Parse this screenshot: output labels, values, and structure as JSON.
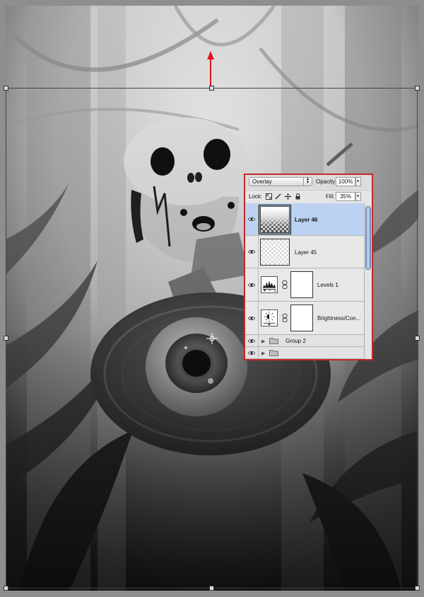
{
  "layers_panel": {
    "blend_mode": "Overlay",
    "opacity_label": "Opacity:",
    "opacity_value": "100%",
    "lock_label": "Lock:",
    "fill_label": "Fill:",
    "fill_value": "35%",
    "layers": [
      {
        "name": "Layer 46",
        "selected": true
      },
      {
        "name": "Layer 45",
        "selected": false
      },
      {
        "name": "Levels 1",
        "selected": false
      },
      {
        "name": "Brightness/Con...",
        "selected": false
      },
      {
        "name": "Group 2",
        "selected": false
      }
    ]
  },
  "colors": {
    "panel_border": "#c62828",
    "arrow": "#e0141e",
    "selection": "#bcd2f2"
  },
  "icons": [
    "eye-icon",
    "lock-transparent-icon",
    "lock-paint-icon",
    "lock-move-icon",
    "lock-all-icon",
    "chain-link-icon",
    "folder-icon",
    "expand-triangle-icon",
    "levels-icon",
    "brightness-contrast-icon",
    "crosshair-icon",
    "arrow-up-icon"
  ]
}
